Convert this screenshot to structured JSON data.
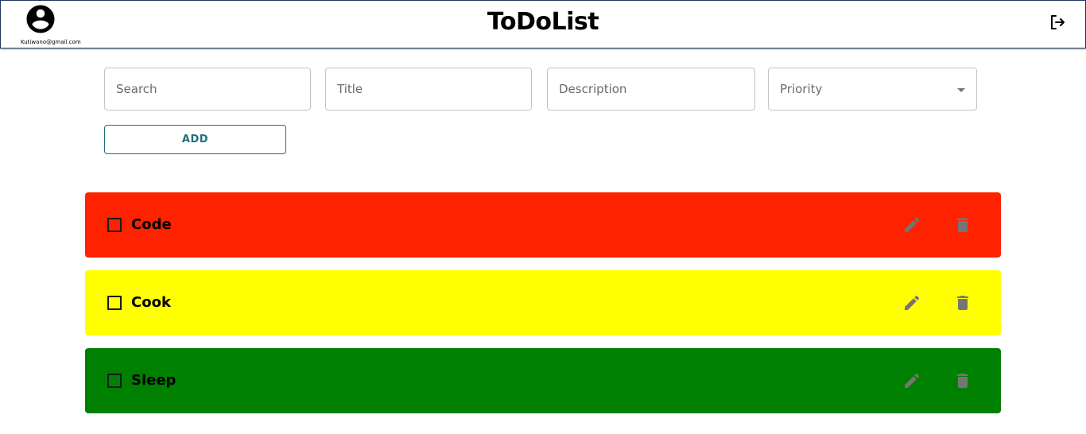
{
  "header": {
    "user_email": "Kutiwano@gmail.com",
    "title": "ToDoList",
    "avatar_icon": "account-circle-icon",
    "logout_icon": "logout-icon"
  },
  "form": {
    "search_placeholder": "Search",
    "title_placeholder": "Title",
    "description_placeholder": "Description",
    "priority_label": "Priority",
    "add_label": "ADD",
    "add_color": "#1f6e7c"
  },
  "todos": [
    {
      "label": "Code",
      "color": "#ff2200",
      "checked": false
    },
    {
      "label": "Cook",
      "color": "#ffff00",
      "checked": false
    },
    {
      "label": "Sleep",
      "color": "#008000",
      "checked": false
    }
  ],
  "icons": {
    "edit": "pencil-icon",
    "delete": "trash-icon",
    "color": "#757575"
  }
}
